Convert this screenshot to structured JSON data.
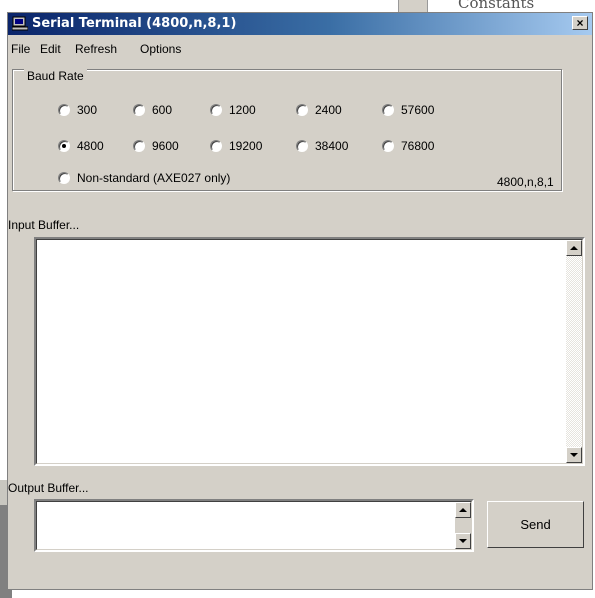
{
  "background": {
    "fragment_text": "Constants"
  },
  "window": {
    "title": "Serial Terminal (4800,n,8,1)",
    "close_glyph": "×",
    "icon": "computer-icon"
  },
  "menu": {
    "items": [
      "File",
      "Edit",
      "Refresh",
      "Options"
    ]
  },
  "baud": {
    "legend": "Baud Rate",
    "selected": "4800",
    "options": [
      "300",
      "600",
      "1200",
      "2400",
      "57600",
      "4800",
      "9600",
      "19200",
      "38400",
      "76800"
    ],
    "nonstandard": "Non-standard (AXE027 only)",
    "status": "4800,n,8,1"
  },
  "input": {
    "label": "Input Buffer..."
  },
  "output": {
    "label": "Output Buffer...",
    "send_label": "Send"
  },
  "colors": {
    "titlebar_start": "#0a246a",
    "titlebar_end": "#a6caf0",
    "face": "#d4d0c8"
  }
}
